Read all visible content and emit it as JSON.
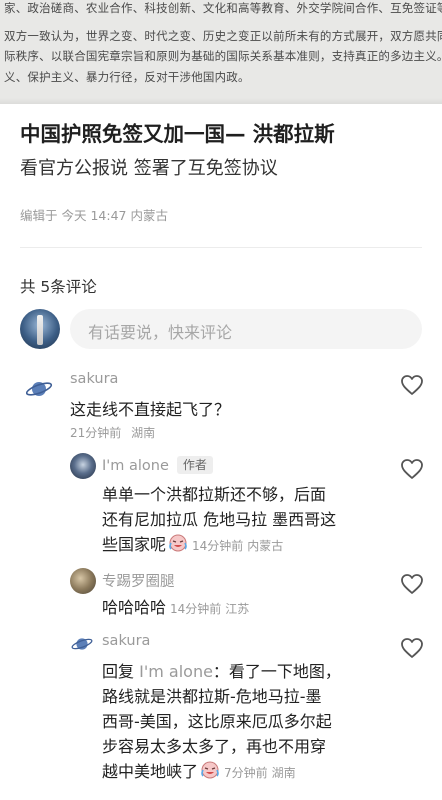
{
  "doc_image": {
    "lines": [
      "家、政治磋商、农业合作、科技创新、文化和高等教育、外交学院间合作、互免签证等领域。",
      "双方一致认为，世界之变、时代之变、历史之变正以前所未有的方式展开，双方愿共同维护以",
      "际秩序、以联合国宪章宗旨和原则为基础的国际关系基本准则，支持真正的多边主义。双方反",
      "义、保护主义、暴力行径，反对干涉他国内政。"
    ]
  },
  "post": {
    "title": "中国护照免签又加一国— 洪都拉斯",
    "body": "看官方公报说 签署了互免签协议",
    "meta": "编辑于 今天 14:47 内蒙古"
  },
  "comments_header": "共 5条评论",
  "comment_input": {
    "placeholder": "有话要说，快来评论"
  },
  "comments": [
    {
      "user": "sakura",
      "text": "这走线不直接起飞了？",
      "time": "21分钟前",
      "location": "湖南"
    },
    {
      "user": "I'm alone",
      "badge": "作者",
      "text_lines": [
        "单单一个洪都拉斯还不够，后面",
        "还有尼加拉瓜 危地马拉 墨西哥这",
        "些国家呢"
      ],
      "time": "14分钟前",
      "location": "内蒙古"
    },
    {
      "user": "专踢罗圈腿",
      "text": "哈哈哈哈",
      "time": "14分钟前",
      "location": "江苏"
    },
    {
      "user": "sakura",
      "reply_prefix": "回复",
      "reply_to": "I'm alone",
      "text_lines": [
        "：看了一下地图，",
        "路线就是洪都拉斯-危地马拉-墨",
        "西哥-美国，这比原来厄瓜多尔起",
        "步容易太多太多了，再也不用穿",
        "越中美地峡了"
      ],
      "time": "7分钟前",
      "location": "湖南"
    }
  ],
  "icons": {
    "like": "heart-outline-icon",
    "planet_avatar": "planet-icon",
    "emoji": "laughing-crying-emoji"
  }
}
